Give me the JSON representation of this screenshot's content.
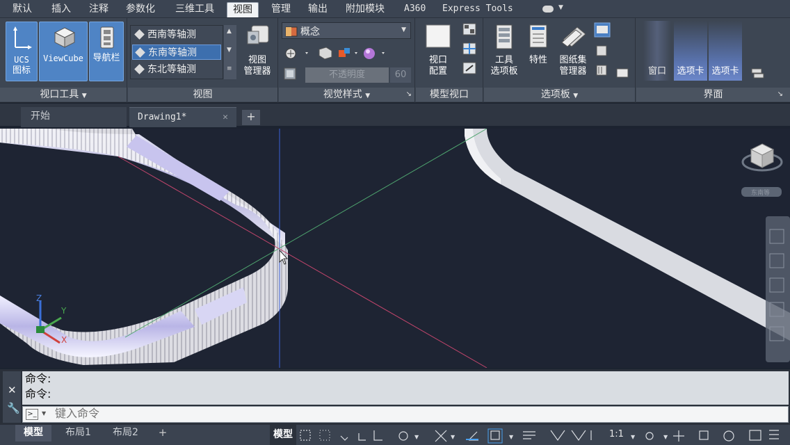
{
  "menu": {
    "tabs": [
      "默认",
      "插入",
      "注释",
      "参数化",
      "三维工具",
      "视图",
      "管理",
      "输出",
      "附加模块",
      "A360",
      "Express Tools"
    ],
    "active": "视图"
  },
  "ribbon": {
    "viewport_tools": {
      "title": "视口工具",
      "ucs_label_1": "UCS",
      "ucs_label_2": "图标",
      "viewcube_label": "ViewCube",
      "navbar_label": "导航栏"
    },
    "views": {
      "title": "视图",
      "items": [
        "西南等轴测",
        "东南等轴测",
        "东北等轴测"
      ],
      "selected": "东南等轴测",
      "manager_label_1": "视图",
      "manager_label_2": "管理器"
    },
    "visual_styles": {
      "title": "视觉样式",
      "style_value": "概念",
      "opacity_label": "不透明度",
      "opacity_value": "60"
    },
    "model_viewports": {
      "title": "模型视口",
      "config_label_1": "视口",
      "config_label_2": "配置"
    },
    "palettes": {
      "title": "选项板",
      "tools_label_1": "工具",
      "tools_label_2": "选项板",
      "properties_label": "特性",
      "sheetset_label_1": "图纸集",
      "sheetset_label_2": "管理器"
    },
    "interface": {
      "title": "界面",
      "window_label": "窗口",
      "tab1_label": "选项卡",
      "tab2_label": "选项卡"
    }
  },
  "doc_tabs": {
    "start": "开始",
    "drawing": "Drawing1*",
    "add": "+"
  },
  "viewport": {
    "viewcube_label": "东南等",
    "axis_z": "Z",
    "axis_y": "Y",
    "axis_x": "X"
  },
  "command": {
    "history": [
      "命令:",
      "命令:"
    ],
    "placeholder": "键入命令"
  },
  "status": {
    "layout_tabs": [
      "模型",
      "布局1",
      "布局2"
    ],
    "model_label": "模型",
    "scale": "1:1"
  },
  "colors": {
    "ribbon_bg": "#3d4653",
    "selected_blue": "#4f84c5",
    "viewport_bg": "#1e2433",
    "command_bg": "#d9dde2"
  }
}
